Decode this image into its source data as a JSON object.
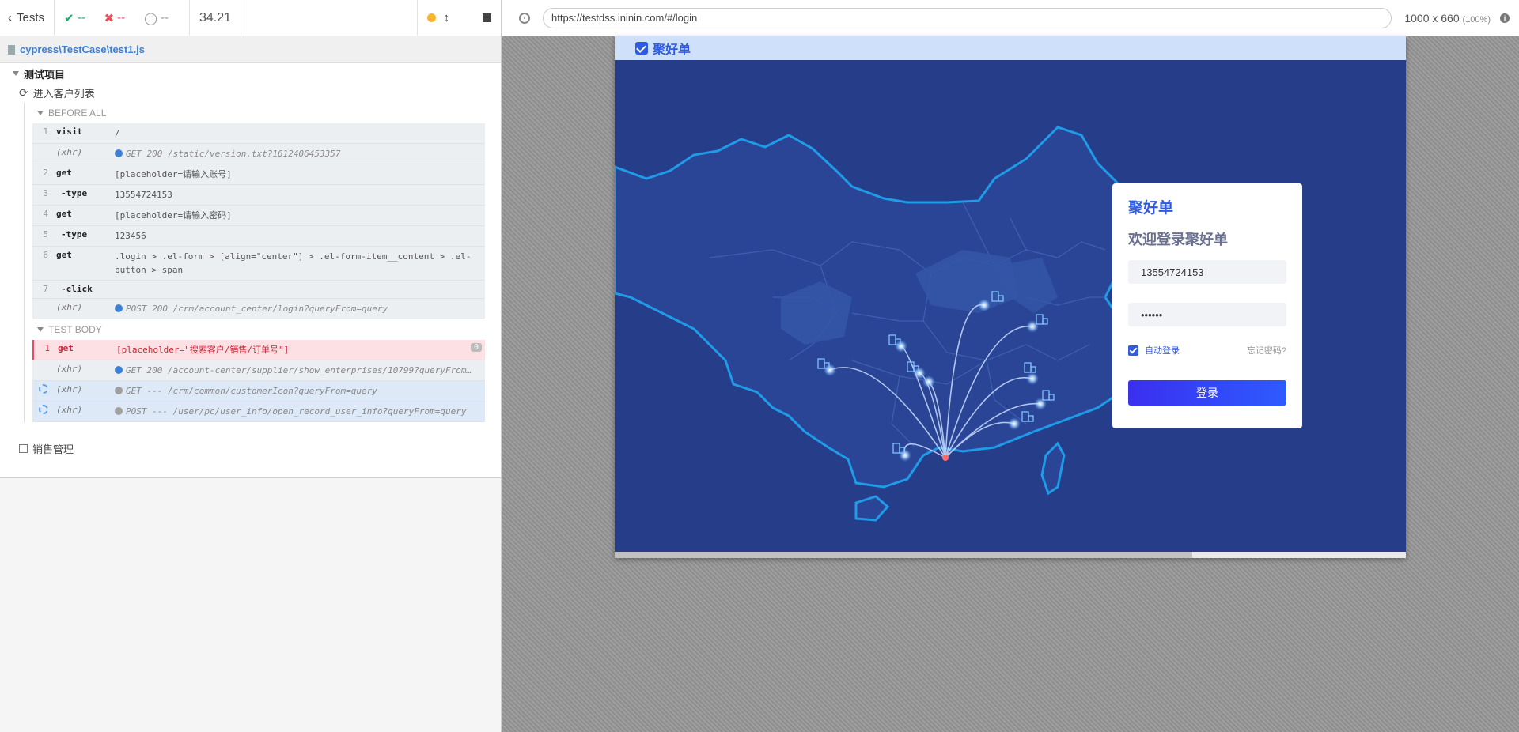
{
  "reporter": {
    "tests_label": "Tests",
    "passed": "--",
    "failed": "--",
    "pending": "--",
    "duration": "34.21",
    "spec_path": "cypress\\TestCase\\test1.js",
    "suite_title": "测试项目",
    "test_title": "进入客户列表",
    "before_all": {
      "title": "BEFORE ALL",
      "commands": [
        {
          "num": "1",
          "name": "visit",
          "msg": "/",
          "kind": "cmd"
        },
        {
          "num": "",
          "name": "(xhr)",
          "msg": "GET 200 /static/version.txt?1612406453357",
          "kind": "xhr"
        },
        {
          "num": "2",
          "name": "get",
          "msg": "[placeholder=请输入账号]",
          "kind": "cmd"
        },
        {
          "num": "3",
          "name": "-type",
          "msg": "13554724153",
          "kind": "sub"
        },
        {
          "num": "4",
          "name": "get",
          "msg": "[placeholder=请输入密码]",
          "kind": "cmd"
        },
        {
          "num": "5",
          "name": "-type",
          "msg": "123456",
          "kind": "sub"
        },
        {
          "num": "6",
          "name": "get",
          "msg": ".login > .el-form > [align=\"center\"] > .el-form-item__content > .el-button > span",
          "kind": "cmd"
        },
        {
          "num": "7",
          "name": "-click",
          "msg": "",
          "kind": "sub"
        },
        {
          "num": "",
          "name": "(xhr)",
          "msg": "POST 200 /crm/account_center/login?queryFrom=query",
          "kind": "xhr"
        }
      ]
    },
    "test_body": {
      "title": "TEST BODY",
      "commands": [
        {
          "num": "1",
          "name": "get",
          "msg": "[placeholder=\"搜索客户/销售/订单号\"]",
          "kind": "failed",
          "badge": "0"
        },
        {
          "num": "",
          "name": "(xhr)",
          "msg": "GET 200 /account-center/supplier/show_enterprises/10799?queryFrom…",
          "kind": "xhr"
        },
        {
          "num": "",
          "name": "(xhr)",
          "msg": "GET --- /crm/common/customerIcon?queryFrom=query",
          "kind": "pending"
        },
        {
          "num": "",
          "name": "(xhr)",
          "msg": "POST --- /user/pc/user_info/open_record_user_info?queryFrom=query",
          "kind": "pending"
        }
      ]
    },
    "second_suite": "销售管理"
  },
  "preview": {
    "url": "https://testdss.ininin.com/#/login",
    "viewport": "1000 x 660",
    "scale": "(100%)"
  },
  "app": {
    "brand": "聚好单",
    "card_brand": "聚好单",
    "welcome": "欢迎登录聚好单",
    "username_value": "13554724153",
    "password_value": "••••••",
    "auto_login": "自动登录",
    "forgot": "忘记密码?",
    "login_button": "登录"
  },
  "colors": {
    "map_bg": "#263d8a",
    "brand_blue": "#2f5be0",
    "pass_green": "#1eaa6a",
    "fail_red": "#e94f5f"
  }
}
